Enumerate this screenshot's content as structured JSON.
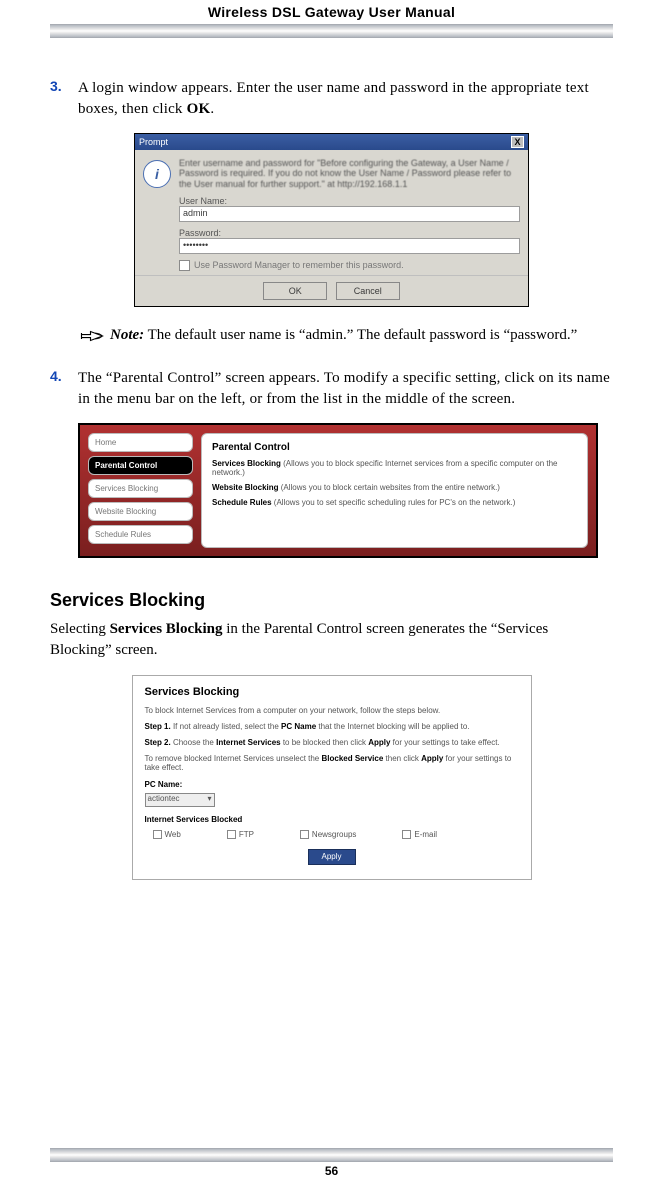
{
  "header_title": "Wireless DSL Gateway User Manual",
  "page_number": "56",
  "step3": {
    "num": "3.",
    "text_a": " A login window appears. Enter the user name and password in the appropriate text boxes, then click ",
    "ok": "OK",
    "text_b": "."
  },
  "login_dialog": {
    "title": "Prompt",
    "close": "X",
    "icon_letter": "i",
    "message": "Enter username and password for \"Before configuring the Gateway, a User Name / Password is required. If you do not know the User Name / Password please refer to the User manual for further support.\" at http://192.168.1.1",
    "user_label": "User Name:",
    "user_value": "admin",
    "pass_label": "Password:",
    "pass_value": "••••••••",
    "pwm_label": "Use Password Manager to remember this password.",
    "ok_btn": "OK",
    "cancel_btn": "Cancel"
  },
  "note": {
    "lead": "Note:",
    "text": " The default user name is “admin.” The default password is “password.”"
  },
  "step4": {
    "num": "4.",
    "text": "The “Parental Control” screen appears. To modify a specific setting, click on its name in the menu bar on the left, or from the list in the middle of the screen."
  },
  "pc": {
    "side": [
      "Home",
      "Parental Control",
      "Services Blocking",
      "Website Blocking",
      "Schedule Rules"
    ],
    "title": "Parental Control",
    "rows": [
      {
        "b": "Services Blocking",
        "t": " (Allows you to block specific Internet services from a specific computer on the network.)"
      },
      {
        "b": "Website Blocking",
        "t": " (Allows you to block certain websites from the entire network.)"
      },
      {
        "b": "Schedule Rules",
        "t": " (Allows you to set specific scheduling rules for PC's on the network.)"
      }
    ]
  },
  "services_heading": "Services Blocking",
  "services_para_a": "Selecting ",
  "services_para_b": "Services Blocking",
  "services_para_c": " in the Parental Control screen generates the “Services Blocking” screen.",
  "sb": {
    "title": "Services Blocking",
    "p1": "To block Internet Services from a computer on your network, follow the steps below.",
    "p2a": "Step 1.",
    "p2b": " If not already listed, select the ",
    "p2c": "PC Name",
    "p2d": " that the Internet blocking will be applied to.",
    "p3a": "Step 2.",
    "p3b": " Choose the ",
    "p3c": "Internet Services",
    "p3d": " to be blocked then click ",
    "p3e": "Apply",
    "p3f": " for your settings to take effect.",
    "p4a": "To remove blocked Internet Services unselect the ",
    "p4b": "Blocked Service",
    "p4c": " then click ",
    "p4d": "Apply",
    "p4e": " for your settings to take effect.",
    "pcname_label": "PC Name:",
    "pcname_value": "actiontec",
    "isb_label": "Internet Services Blocked",
    "checks": [
      "Web",
      "FTP",
      "Newsgroups",
      "E-mail"
    ],
    "apply": "Apply"
  }
}
